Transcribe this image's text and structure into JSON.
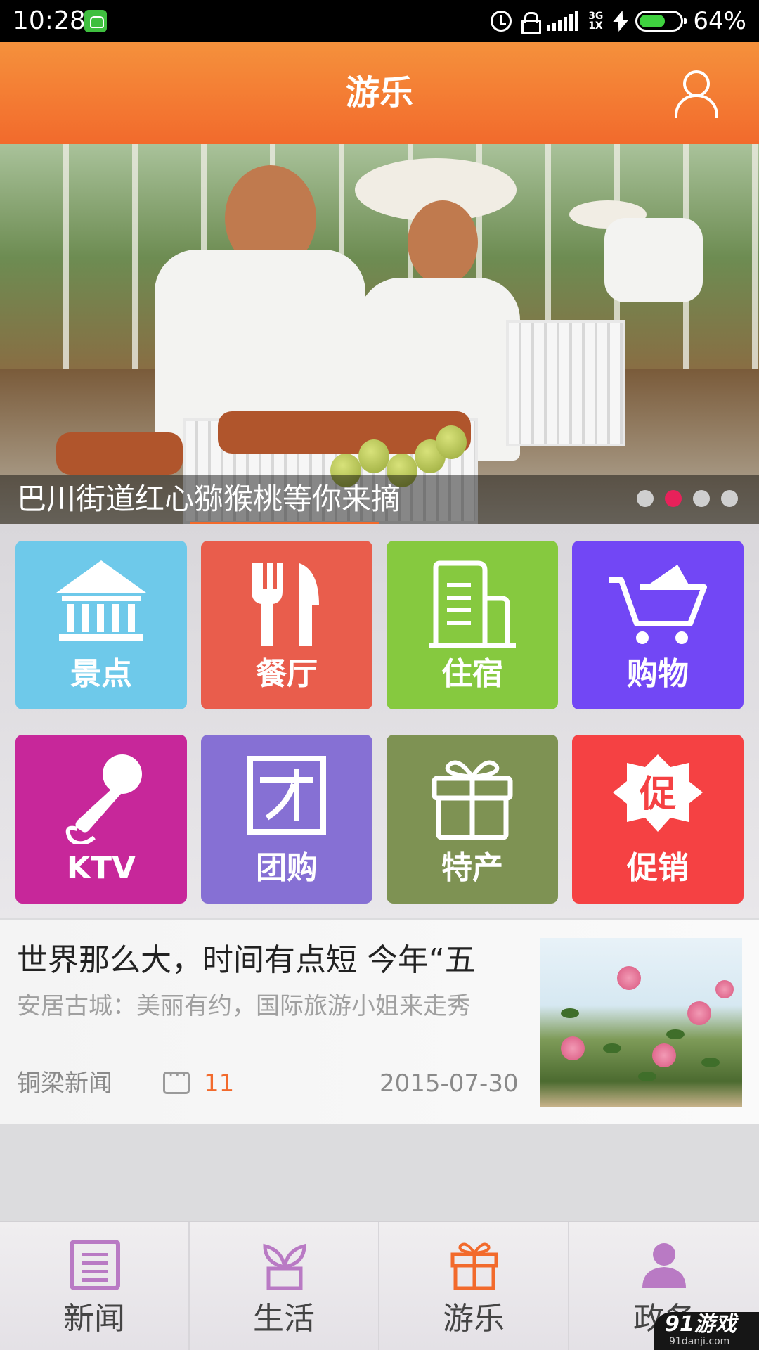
{
  "status_bar": {
    "time": "10:28",
    "network": "3G\n1X",
    "battery_percent": "64%"
  },
  "header": {
    "title": "游乐",
    "user_icon": "user-icon"
  },
  "banner": {
    "caption": "巴川街道红心猕猴桃等你来摘",
    "page_count": 4,
    "active_index": 1,
    "colors": {
      "active_dot": "#e8215a",
      "dot": "#cfcfcf"
    }
  },
  "categories": [
    {
      "label": "景点",
      "icon": "temple-icon",
      "color": "#6ec9ea"
    },
    {
      "label": "餐厅",
      "icon": "fork-knife-icon",
      "color": "#e95d4c"
    },
    {
      "label": "住宿",
      "icon": "hotel-building-icon",
      "color": "#86c93f"
    },
    {
      "label": "购物",
      "icon": "shopping-cart-icon",
      "color": "#7247f5"
    },
    {
      "label": "KTV",
      "icon": "microphone-icon",
      "color": "#c7279a"
    },
    {
      "label": "团购",
      "icon": "group-buy-icon",
      "color": "#8670d4"
    },
    {
      "label": "特产",
      "icon": "gift-icon",
      "color": "#7e9253"
    },
    {
      "label": "促销",
      "icon": "promo-badge-icon",
      "color": "#f54143"
    }
  ],
  "news": {
    "title": "世界那么大，时间有点短 今年“五",
    "subtitle": "安居古城：美丽有约，国际旅游小姐来走秀",
    "source": "铜梁新闻",
    "comments": "11",
    "date": "2015-07-30"
  },
  "bottom_nav": [
    {
      "label": "新闻",
      "icon": "news-icon",
      "active": false
    },
    {
      "label": "生活",
      "icon": "plant-icon",
      "active": false
    },
    {
      "label": "游乐",
      "icon": "gift-icon",
      "active": true
    },
    {
      "label": "政务",
      "icon": "person-icon",
      "active": false
    }
  ],
  "watermark": {
    "text": "91游戏",
    "sub": "91danji.com"
  },
  "colors": {
    "accent": "#f26a2c",
    "nav_icon": "#b97ac4",
    "nav_icon_active": "#f26a2c"
  }
}
